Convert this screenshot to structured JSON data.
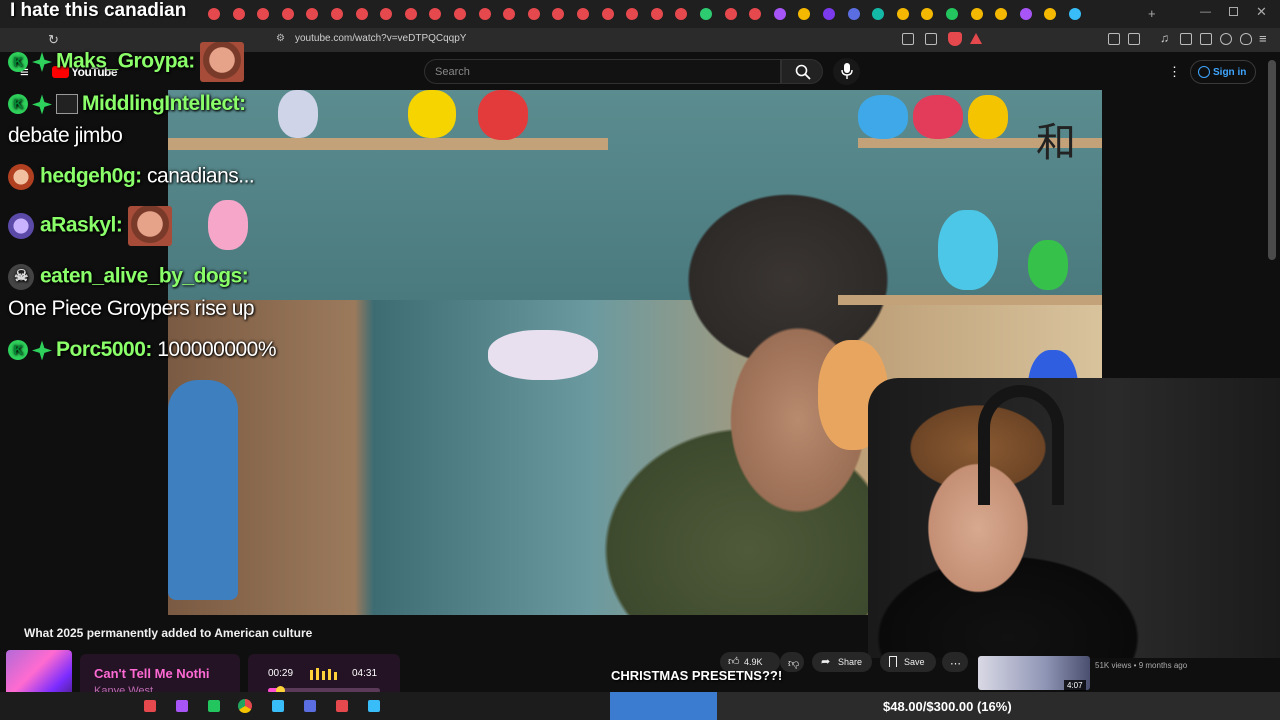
{
  "browser": {
    "url": "youtube.com/watch?v=veDTPQCqqpY",
    "tab_colors": [
      "#e5484d",
      "#e5484d",
      "#e5484d",
      "#e5484d",
      "#e5484d",
      "#e5484d",
      "#e5484d",
      "#e5484d",
      "#e5484d",
      "#e5484d",
      "#e5484d",
      "#e5484d",
      "#e5484d",
      "#e5484d",
      "#e5484d",
      "#e5484d",
      "#e5484d",
      "#e5484d",
      "#e5484d",
      "#e5484d",
      "#2ecc71",
      "#e5484d",
      "#e5484d",
      "#a855f7",
      "#f5b800",
      "#7c3aed",
      "#5b6ee1",
      "#14b8a6",
      "#f5b800",
      "#f5b800",
      "#22c55e",
      "#f5b800",
      "#f5b800",
      "#a855f7",
      "#f5b800",
      "#38bdf8"
    ]
  },
  "youtube": {
    "logo": "YouTube",
    "search_placeholder": "Search",
    "signin": "Sign in",
    "video_title": "What 2025 permanently added to American culture",
    "likes": "4.9K",
    "share": "Share",
    "save": "Save",
    "related_meta": "51K views • 9 months ago",
    "related_duration": "4:07"
  },
  "stream": {
    "title": "I hate this canadian",
    "chat": [
      {
        "user": "Maks_Groypa:",
        "text": "",
        "emote": true
      },
      {
        "user": "MiddlingIntellect:",
        "text": "debate jimbo"
      },
      {
        "user": "hedgeh0g:",
        "text": "canadians..."
      },
      {
        "user": "aRaskyl:",
        "text": "",
        "emote": true
      },
      {
        "user": "eaten_alive_by_dogs:",
        "text": "One Piece Groypers rise up"
      },
      {
        "user": "Porc5000:",
        "text": "100000000%"
      }
    ],
    "caption": "CHRISTMAS PRESETNS??!",
    "music": {
      "title": "Can't Tell Me Nothi",
      "artist": "Kanye West",
      "current": "00:29",
      "total": "04:31",
      "progress": 0.107
    },
    "goal": {
      "text": "$48.00/$300.00 (16%)",
      "progress": 0.16
    }
  },
  "colors": {
    "chat_username": "#8aff6a",
    "music_accent": "#ff4fd0",
    "goal_fill": "#3b7bd0"
  }
}
